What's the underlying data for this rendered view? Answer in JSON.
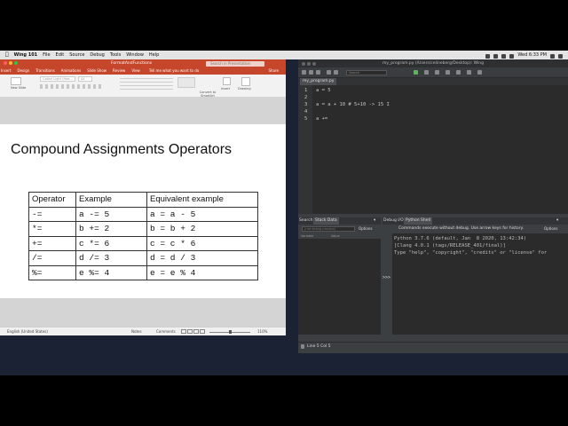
{
  "menubar": {
    "app_name": "Wing 101",
    "items": [
      "File",
      "Edit",
      "Source",
      "Debug",
      "Tools",
      "Window",
      "Help"
    ],
    "clock": "Wed 6:33 PM"
  },
  "powerpoint": {
    "filename": "FormatAndFunctions",
    "search_placeholder": "Search in Presentation",
    "tabs": [
      "Insert",
      "Design",
      "Transitions",
      "Animations",
      "Slide Show",
      "Review",
      "View"
    ],
    "tell_me": "Tell me what you want to do",
    "share": "Share",
    "ribbon": {
      "new_slide": "New Slide",
      "font": "Calibri Light (Hea…",
      "font_size": "44",
      "convert": "Convert to SmartArt",
      "insert": "Insert",
      "drawing": "Drawing"
    },
    "slide": {
      "title": "Compound Assignments Operators",
      "table": {
        "headers": [
          "Operator",
          "Example",
          "Equivalent example"
        ],
        "rows": [
          [
            "-=",
            "a -= 5",
            "a = a - 5"
          ],
          [
            "*=",
            "b += 2",
            "b = b + 2"
          ],
          [
            "+=",
            "c *= 6",
            "c = c * 6"
          ],
          [
            "/=",
            "d /= 3",
            "d = d / 3"
          ],
          [
            "%=",
            "e %= 4",
            "e = e % 4"
          ]
        ]
      }
    },
    "status": {
      "language": "English (United States)",
      "notes": "Notes",
      "comments": "Comments",
      "zoom": "110%"
    }
  },
  "wing": {
    "title": "my_program.py (/Users/celineberg/Desktop): Wing",
    "search_placeholder": "Search",
    "file_tab": "my_program.py",
    "editor_lines": [
      {
        "n": "1",
        "code": "a = 5"
      },
      {
        "n": "2",
        "code": ""
      },
      {
        "n": "3",
        "code": "a = a + 10 # 5+10 -> 15 I"
      },
      {
        "n": "4",
        "code": ""
      },
      {
        "n": "5",
        "code": "a +="
      }
    ],
    "left_panel": {
      "tab1": "Search",
      "tab2": "Stack Data",
      "toolbar": "(not debug process)",
      "options": "Options",
      "col1": "Variable",
      "col2": "Value"
    },
    "right_panel": {
      "tab1": "Debug I/O",
      "tab2": "Python Shell",
      "hint": "Commands execute without debug.  Use arrow keys for history.",
      "options": "Options",
      "prompt": ">>>",
      "shell_lines": [
        "Python 3.7.6 (default, Jan  8 2020, 13:42:34)",
        "[Clang 4.0.1 (tags/RELEASE_401/final)]",
        "Type \"help\", \"copyright\", \"credits\" or \"license\" for"
      ]
    },
    "status": "Line 5 Col 5"
  }
}
